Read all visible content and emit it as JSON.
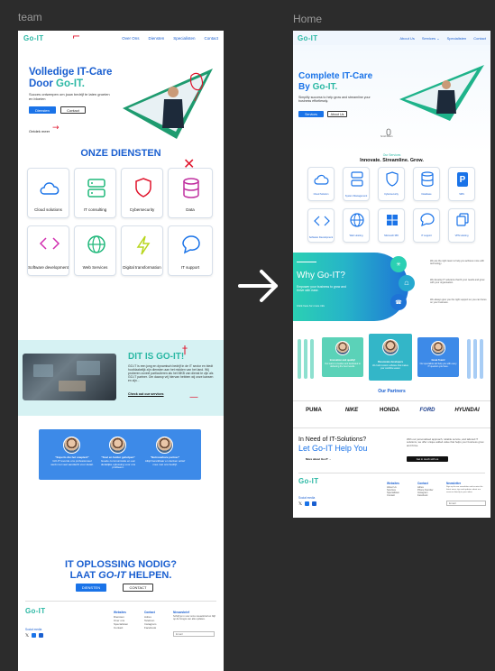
{
  "canvas": {
    "frame_left_label": "team",
    "frame_right_label": "Home"
  },
  "team_page": {
    "logo": "Go-IT",
    "nav": [
      "Over Ons",
      "Diensten",
      "Specialisten",
      "Contact"
    ],
    "hero": {
      "title_line1": "Volledige IT-Care",
      "title_line2_prefix": "Door ",
      "title_line2_accent": "Go-IT.",
      "subtitle": "Succes ontwerpen om jouw bedrijf te laten groeien en bloeien",
      "btn_primary": "Diensten",
      "btn_secondary": "Contact",
      "scroll_hint": "Ontdek meer"
    },
    "services_title": "ONZE DIENSTEN",
    "services": [
      {
        "label": "Cloud solutions",
        "icon": "cloud-icon"
      },
      {
        "label": "IT consulting",
        "icon": "server-icon"
      },
      {
        "label": "Cybersecurity",
        "icon": "shield-icon"
      },
      {
        "label": "Data",
        "icon": "database-icon"
      },
      {
        "label": "Software development",
        "icon": "code-icon"
      },
      {
        "label": "Web Services",
        "icon": "globe-icon"
      },
      {
        "label": "Digital transformation",
        "icon": "lightning-icon"
      },
      {
        "label": "IT support",
        "icon": "chat-icon"
      }
    ],
    "about": {
      "title": "DIT IS GO-IT!",
      "body": "GO-IT is een jong en dynamisch bedrijf in de IT sector en biedt hoofdzakelijk zijn diensten aan het midden van het land. Wij proberen zoveel particulieren als het MKB van dienst te zijn als GO-IT partner. Om daarop vrij hiervan hebben wij onze kansen en zijn...",
      "link": "Check out our services"
    },
    "testimonials": [
      {
        "title": "\"Experts die het snapten!\"",
        "body": "GO-IT leverde ons professioneel werk met veel aandacht voor detail."
      },
      {
        "title": "\"Snel en helder geholpen\"",
        "body": "Goede communicatie en een duidelijke oplossing voor ons probleem."
      },
      {
        "title": "\"Betrouwbare partner\"",
        "body": "Altijd bereikbaar en denken actief mee met ons bedrijf."
      }
    ],
    "cta": {
      "line1": "IT OPLOSSING NODIG?",
      "line2_prefix": "LAAT ",
      "line2_accent": "GO-IT",
      "line2_suffix": " HELPEN.",
      "btn_primary": "DIENSTEN",
      "btn_secondary": "CONTACT"
    },
    "footer": {
      "logo": "Go-IT",
      "social_label": "Social media",
      "col1_title": "Websites",
      "col1_items": [
        "Diensten",
        "Over ons",
        "Specialisten",
        "Contact"
      ],
      "col2_title": "Contact",
      "col2_items": [
        "Adres",
        "Telefoon",
        "Instagram",
        "Facebook"
      ],
      "col3_title": "Nieuwsbrief",
      "col3_text": "Schrijf je in voor onze nieuwsbrief en blijf op de hoogte van alle updates.",
      "email_placeholder": "Email"
    }
  },
  "home_page": {
    "logo": "Go-IT",
    "nav": [
      "About Us",
      "Services ⌄",
      "Specialisten",
      "Contact"
    ],
    "hero": {
      "title_line1": "Complete IT-Care",
      "title_line2_prefix": "By ",
      "title_line2_accent": "Go-IT.",
      "subtitle": "Simplify success to help grow and streamline your business effortlessly.",
      "btn_primary": "Services",
      "btn_secondary": "About Us",
      "scroll_hint": "Scroll Down"
    },
    "services_kicker": "Our Services",
    "services_title": "Innovate. Streamline. Grow.",
    "services": [
      {
        "label": "Cloud Solution",
        "icon": "cloud-icon"
      },
      {
        "label": "System Management",
        "icon": "server-icon"
      },
      {
        "label": "Cybersecurity",
        "icon": "shield-icon"
      },
      {
        "label": "Database",
        "icon": "database-icon"
      },
      {
        "label": "SMS",
        "icon": "parking-icon"
      },
      {
        "label": "Software Development",
        "icon": "code-icon"
      },
      {
        "label": "Web Hosting",
        "icon": "globe-icon"
      },
      {
        "label": "Microsoft 365",
        "icon": "windows-icon"
      },
      {
        "label": "IT support",
        "icon": "chat-icon"
      },
      {
        "label": "VPN Hosting",
        "icon": "copy-icon"
      }
    ],
    "why": {
      "title": "Why Go-IT?",
      "body": "Empower your business to grow and thrive with ease.",
      "link": "Click here for more info",
      "points": [
        "We are the right team to help you achieve more with technology.",
        "We develop IT solutions that fit your needs and grow with your organisation.",
        "We always give you the right support so you can focus on your business."
      ]
    },
    "team": [
      {
        "title": "Innovation and quality!",
        "body": "Our team is creative and dedicated to delivering the best results."
      },
      {
        "title": "Passionate developers",
        "body": "We build custom software that makes your workflow easier."
      },
      {
        "title": "Great Team!",
        "body": "Our specialists will help you with every IT question you have."
      }
    ],
    "partners_title": "Our Partners",
    "partners": [
      "PUMA",
      "NIKE",
      "HONDA",
      "FORD",
      "HYUNDAI"
    ],
    "cta": {
      "line1": "In Need of IT-Solutions?",
      "line2": "Let Go-IT Help You",
      "text": "With our personalised approach, reliable service, and tailored IT solutions, we offer unique added value that helps your business grow and thrive.",
      "link": "More about Go-IT →",
      "btn": "Get in touch with us"
    },
    "footer": {
      "logo": "Go-IT",
      "social_label": "Social media",
      "col1_title": "Websites",
      "col1_items": [
        "About Us",
        "Services",
        "Specialisten",
        "Contact"
      ],
      "col2_title": "Contact",
      "col2_items": [
        "Adres",
        "Phone Number",
        "Instagram",
        "Facebook"
      ],
      "col3_title": "Newsletter",
      "col3_text": "Sign up for our newsletter and receive the latest news, tips and updates about our services directly in your inbox.",
      "email_placeholder": "Email"
    }
  },
  "colors": {
    "brand_blue": "#1a5fd0",
    "brand_teal": "#2bb8a4",
    "button_blue": "#1a73e8",
    "annotation_red": "#e0142c"
  }
}
